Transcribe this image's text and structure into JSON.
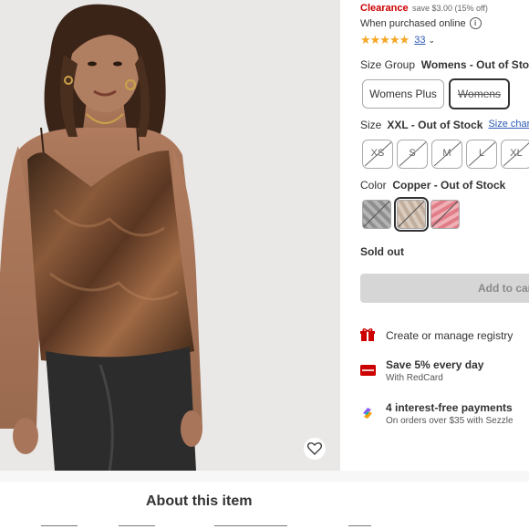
{
  "pricing": {
    "clearance_label": "Clearance",
    "savings": "save $3.00 (15% off)",
    "purchased_online": "When purchased online",
    "info_icon": "ⓘ"
  },
  "rating": {
    "stars": "★★★★★",
    "score": 4.5,
    "review_count": "33",
    "chevron": "⌄"
  },
  "size_group": {
    "label": "Size Group",
    "selected": "Womens - Out of Stock",
    "options": [
      "Womens Plus",
      "Womens"
    ]
  },
  "size": {
    "label": "Size",
    "selected": "XXL - Out of Stock",
    "size_chart_link": "Size chart",
    "options": [
      "XS",
      "S",
      "M",
      "L",
      "XL"
    ]
  },
  "color": {
    "label": "Color",
    "selected": "Copper - Out of Stock",
    "swatches": [
      {
        "name": "silver",
        "color": "#9e9e9e"
      },
      {
        "name": "copper",
        "color": "#c9b8a8"
      },
      {
        "name": "pink",
        "color": "#e8949c"
      }
    ]
  },
  "availability": {
    "sold_out": "Sold out",
    "add_to_cart": "Add to cart"
  },
  "features": [
    {
      "icon": "gift-icon",
      "title": "Create or manage registry",
      "subtitle": ""
    },
    {
      "icon": "redcard-icon",
      "title": "Save 5% every day",
      "subtitle": "With RedCard"
    },
    {
      "icon": "sezzle-icon",
      "title": "4 interest-free payments",
      "subtitle": "On orders over $35 with Sezzle"
    }
  ],
  "about": {
    "title": "About this item"
  },
  "colors": {
    "accent": "#cc0000",
    "link": "#2c5bb3",
    "star": "#f5a623"
  }
}
